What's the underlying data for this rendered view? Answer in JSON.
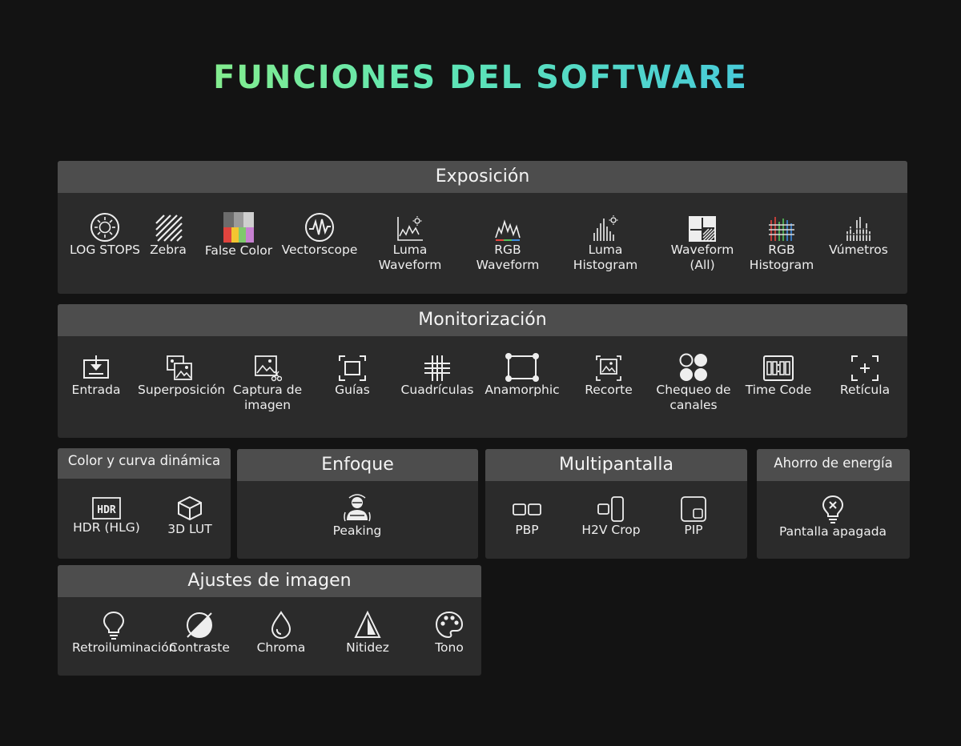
{
  "title": "FUNCIONES DEL SOFTWARE",
  "colors": {
    "background": "#131313",
    "panel": "#2b2b2b",
    "panel_header": "#4d4d4d",
    "gradient_start": "#a6f36a",
    "gradient_end": "#38b8f2"
  },
  "exposicion": {
    "title": "Exposición",
    "items": [
      {
        "label": "LOG STOPS",
        "icon": "aperture-icon"
      },
      {
        "label": "Zebra",
        "icon": "zebra-stripes-icon"
      },
      {
        "label": "False Color",
        "icon": "false-color-swatch-icon"
      },
      {
        "label": "Vectorscope",
        "icon": "vectorscope-icon"
      },
      {
        "label": "Luma\nWaveform",
        "icon": "luma-waveform-icon"
      },
      {
        "label": "RGB\nWaveform",
        "icon": "rgb-waveform-icon"
      },
      {
        "label": "Luma\nHistogram",
        "icon": "luma-histogram-icon"
      },
      {
        "label": "Waveform\n(All)",
        "icon": "waveform-all-icon"
      },
      {
        "label": "RGB\nHistogram",
        "icon": "rgb-histogram-icon"
      },
      {
        "label": "Vúmetros",
        "icon": "vu-meter-icon"
      }
    ]
  },
  "monitorizacion": {
    "title": "Monitorización",
    "items": [
      {
        "label": "Entrada",
        "icon": "input-icon"
      },
      {
        "label": "Superposición",
        "icon": "overlay-icon"
      },
      {
        "label": "Captura de\nimagen",
        "icon": "image-capture-icon"
      },
      {
        "label": "Guías",
        "icon": "guides-icon"
      },
      {
        "label": "Cuadrículas",
        "icon": "grid-icon"
      },
      {
        "label": "Anamorphic",
        "icon": "anamorphic-icon"
      },
      {
        "label": "Recorte",
        "icon": "crop-icon"
      },
      {
        "label": "Chequeo de\ncanales",
        "icon": "channel-check-icon"
      },
      {
        "label": "Time Code",
        "icon": "time-code-icon"
      },
      {
        "label": "Retícula",
        "icon": "reticle-icon"
      }
    ]
  },
  "color": {
    "title": "Color y curva dinámica",
    "items": [
      {
        "label": "HDR (HLG)",
        "icon": "hdr-icon"
      },
      {
        "label": "3D LUT",
        "icon": "cube-icon"
      }
    ]
  },
  "enfoque": {
    "title": "Enfoque",
    "items": [
      {
        "label": "Peaking",
        "icon": "peaking-person-icon"
      }
    ]
  },
  "multipantalla": {
    "title": "Multipantalla",
    "items": [
      {
        "label": "PBP",
        "icon": "pbp-icon"
      },
      {
        "label": "H2V Crop",
        "icon": "h2v-crop-icon"
      },
      {
        "label": "PIP",
        "icon": "pip-icon"
      }
    ]
  },
  "ahorro": {
    "title": "Ahorro de energía",
    "items": [
      {
        "label": "Pantalla apagada",
        "icon": "bulb-off-icon"
      }
    ]
  },
  "ajustes": {
    "title": "Ajustes de imagen",
    "items": [
      {
        "label": "Retroiluminación",
        "icon": "bulb-icon"
      },
      {
        "label": "Contraste",
        "icon": "contrast-icon"
      },
      {
        "label": "Chroma",
        "icon": "drop-icon"
      },
      {
        "label": "Nitidez",
        "icon": "sharpness-icon"
      },
      {
        "label": "Tono",
        "icon": "palette-icon"
      }
    ]
  }
}
